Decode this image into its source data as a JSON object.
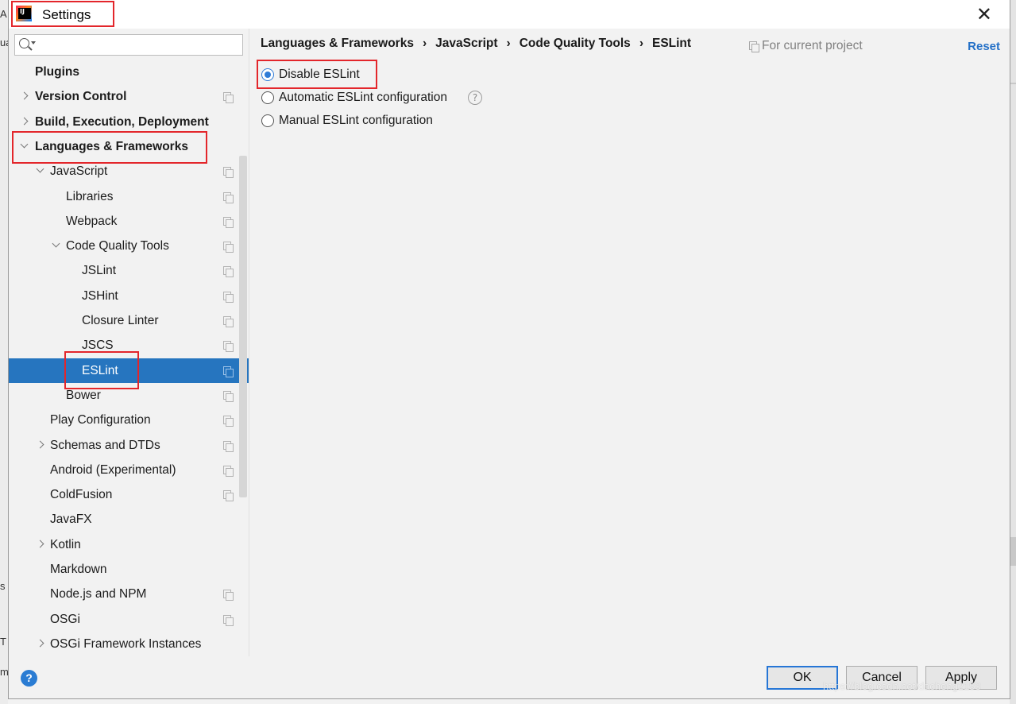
{
  "window": {
    "title": "Settings",
    "close_symbol": "✕"
  },
  "background_fragments": [
    "A",
    "ua",
    "s",
    "T",
    "m"
  ],
  "search": {
    "value": "",
    "placeholder": ""
  },
  "tree": [
    {
      "label": "Plugins",
      "bold": true,
      "level": 0,
      "arrow": "none",
      "copy": false,
      "selected": false
    },
    {
      "label": "Version Control",
      "bold": true,
      "level": 0,
      "arrow": "right",
      "copy": true,
      "selected": false
    },
    {
      "label": "Build, Execution, Deployment",
      "bold": true,
      "level": 0,
      "arrow": "right",
      "copy": false,
      "selected": false
    },
    {
      "label": "Languages & Frameworks",
      "bold": true,
      "level": 0,
      "arrow": "down",
      "copy": false,
      "selected": false
    },
    {
      "label": "JavaScript",
      "bold": false,
      "level": 1,
      "arrow": "down",
      "copy": true,
      "selected": false
    },
    {
      "label": "Libraries",
      "bold": false,
      "level": 2,
      "arrow": "none",
      "copy": true,
      "selected": false
    },
    {
      "label": "Webpack",
      "bold": false,
      "level": 2,
      "arrow": "none",
      "copy": true,
      "selected": false
    },
    {
      "label": "Code Quality Tools",
      "bold": false,
      "level": 2,
      "arrow": "down",
      "copy": true,
      "selected": false
    },
    {
      "label": "JSLint",
      "bold": false,
      "level": 3,
      "arrow": "none",
      "copy": true,
      "selected": false
    },
    {
      "label": "JSHint",
      "bold": false,
      "level": 3,
      "arrow": "none",
      "copy": true,
      "selected": false
    },
    {
      "label": "Closure Linter",
      "bold": false,
      "level": 3,
      "arrow": "none",
      "copy": true,
      "selected": false
    },
    {
      "label": "JSCS",
      "bold": false,
      "level": 3,
      "arrow": "none",
      "copy": true,
      "selected": false
    },
    {
      "label": "ESLint",
      "bold": false,
      "level": 3,
      "arrow": "none",
      "copy": true,
      "selected": true
    },
    {
      "label": "Bower",
      "bold": false,
      "level": 2,
      "arrow": "none",
      "copy": true,
      "selected": false
    },
    {
      "label": "Play Configuration",
      "bold": false,
      "level": 1,
      "arrow": "none",
      "copy": true,
      "selected": false
    },
    {
      "label": "Schemas and DTDs",
      "bold": false,
      "level": 1,
      "arrow": "right",
      "copy": true,
      "selected": false
    },
    {
      "label": "Android (Experimental)",
      "bold": false,
      "level": 1,
      "arrow": "none",
      "copy": true,
      "selected": false
    },
    {
      "label": "ColdFusion",
      "bold": false,
      "level": 1,
      "arrow": "none",
      "copy": true,
      "selected": false
    },
    {
      "label": "JavaFX",
      "bold": false,
      "level": 1,
      "arrow": "none",
      "copy": false,
      "selected": false
    },
    {
      "label": "Kotlin",
      "bold": false,
      "level": 1,
      "arrow": "right",
      "copy": false,
      "selected": false
    },
    {
      "label": "Markdown",
      "bold": false,
      "level": 1,
      "arrow": "none",
      "copy": false,
      "selected": false
    },
    {
      "label": "Node.js and NPM",
      "bold": false,
      "level": 1,
      "arrow": "none",
      "copy": true,
      "selected": false
    },
    {
      "label": "OSGi",
      "bold": false,
      "level": 1,
      "arrow": "none",
      "copy": true,
      "selected": false
    },
    {
      "label": "OSGi Framework Instances",
      "bold": false,
      "level": 1,
      "arrow": "right",
      "copy": false,
      "selected": false
    }
  ],
  "breadcrumb": [
    "Languages & Frameworks",
    "JavaScript",
    "Code Quality Tools",
    "ESLint"
  ],
  "breadcrumb_separator": "›",
  "scope_label": "For current project",
  "reset_label": "Reset",
  "options": [
    {
      "label": "Disable ESLint",
      "checked": true,
      "help": false
    },
    {
      "label": "Automatic ESLint configuration",
      "checked": false,
      "help": true
    },
    {
      "label": "Manual ESLint configuration",
      "checked": false,
      "help": false
    }
  ],
  "help_symbol": "?",
  "buttons": {
    "ok": "OK",
    "cancel": "Cancel",
    "apply": "Apply"
  },
  "watermark": "https://blog.csdn.net/dacheng2153",
  "colors": {
    "selection": "#2675bf",
    "accent": "#2676d6",
    "annotation": "#e3262b",
    "link": "#2470c7"
  }
}
